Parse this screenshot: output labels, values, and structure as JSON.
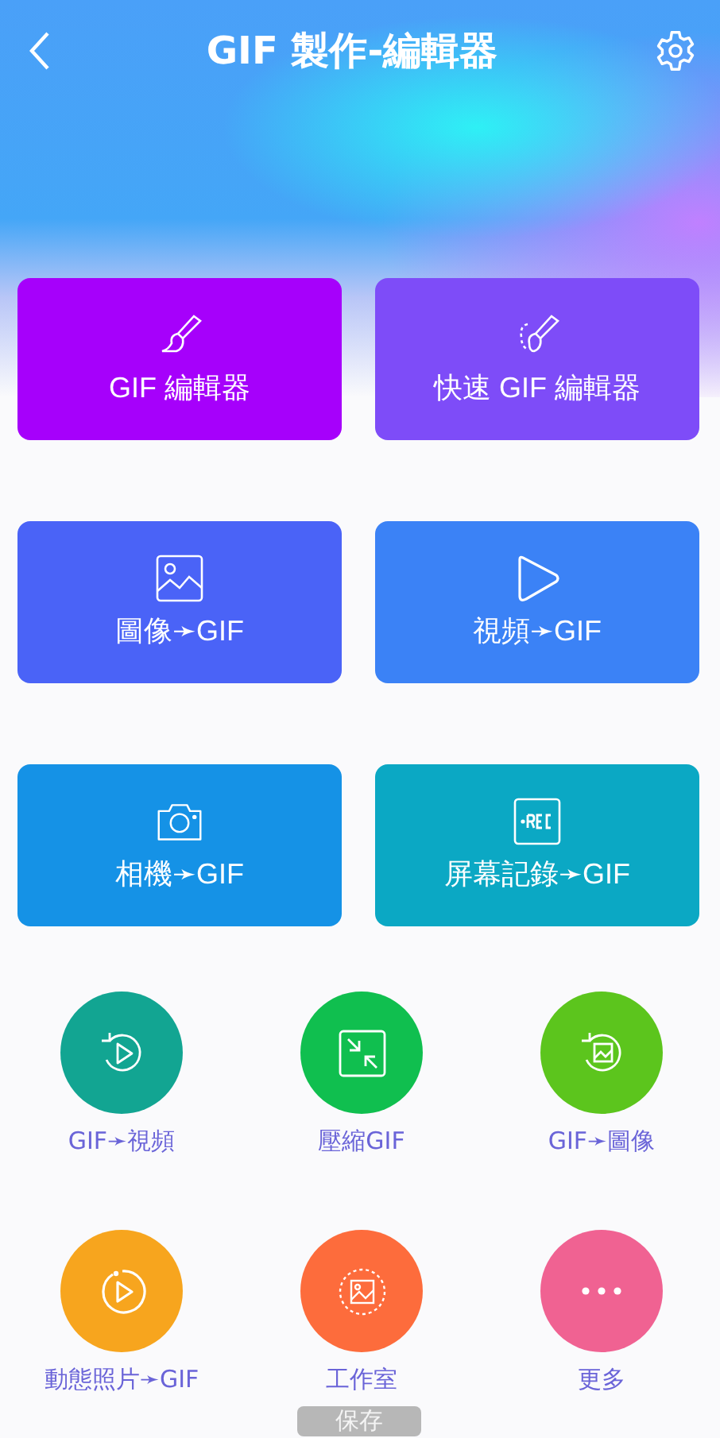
{
  "header": {
    "title": "GIF 製作-編輯器"
  },
  "cards": [
    {
      "label": "GIF 編輯器",
      "color": "#a600fb"
    },
    {
      "label": "快速 GIF 編輯器",
      "color": "#7e4cf8"
    },
    {
      "label": "圖像➛GIF",
      "color": "#4a63f7"
    },
    {
      "label": "視頻➛GIF",
      "color": "#3b82f6"
    },
    {
      "label": "相機➛GIF",
      "color": "#1592e6"
    },
    {
      "label": "屏幕記錄➛GIF",
      "color": "#0ba8c4"
    }
  ],
  "tools": [
    {
      "label": "GIF➛視頻",
      "color": "#12a592"
    },
    {
      "label": "壓縮GIF",
      "color": "#10bf4f"
    },
    {
      "label": "GIF➛圖像",
      "color": "#5cc51d"
    },
    {
      "label": "動態照片➛GIF",
      "color": "#f7a51e"
    },
    {
      "label": "工作室",
      "color": "#fd6c3c"
    },
    {
      "label": "更多",
      "color": "#f06292"
    }
  ],
  "toast": {
    "text": "保存"
  }
}
